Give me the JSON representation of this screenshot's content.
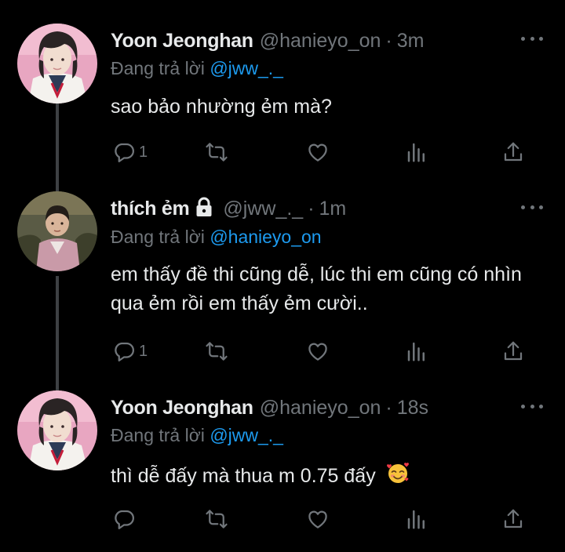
{
  "tweets": [
    {
      "name": "Yoon Jeonghan",
      "handle": "@hanieyo_on",
      "time": "3m",
      "reply_prefix": "Đang trả lời",
      "reply_to": "@jww_._",
      "text": "sao bảo nhường ẻm mà?",
      "reply_count": "1"
    },
    {
      "name": "thích ẻm",
      "handle": "@jww_._",
      "time": "1m",
      "reply_prefix": "Đang trả lời",
      "reply_to": "@hanieyo_on",
      "text": "em thấy đề thi cũng dễ, lúc thi em cũng có nhìn qua ẻm rồi em thấy ẻm cười..",
      "reply_count": "1"
    },
    {
      "name": "Yoon Jeonghan",
      "handle": "@hanieyo_on",
      "time": "18s",
      "reply_prefix": "Đang trả lời",
      "reply_to": "@jww_._",
      "text": "thì dễ đấy mà thua m 0.75 đấy",
      "reply_count": ""
    }
  ],
  "separator": "·",
  "colors": {
    "background": "#000000",
    "text": "#e7e9ea",
    "secondary": "#71767b",
    "mention": "#1d9bf0",
    "thread_line": "#3e4144"
  },
  "icons": [
    "reply-icon",
    "retweet-icon",
    "like-icon",
    "views-icon",
    "share-icon",
    "lock-icon",
    "more-icon",
    "smiling-face-with-hearts-emoji"
  ]
}
